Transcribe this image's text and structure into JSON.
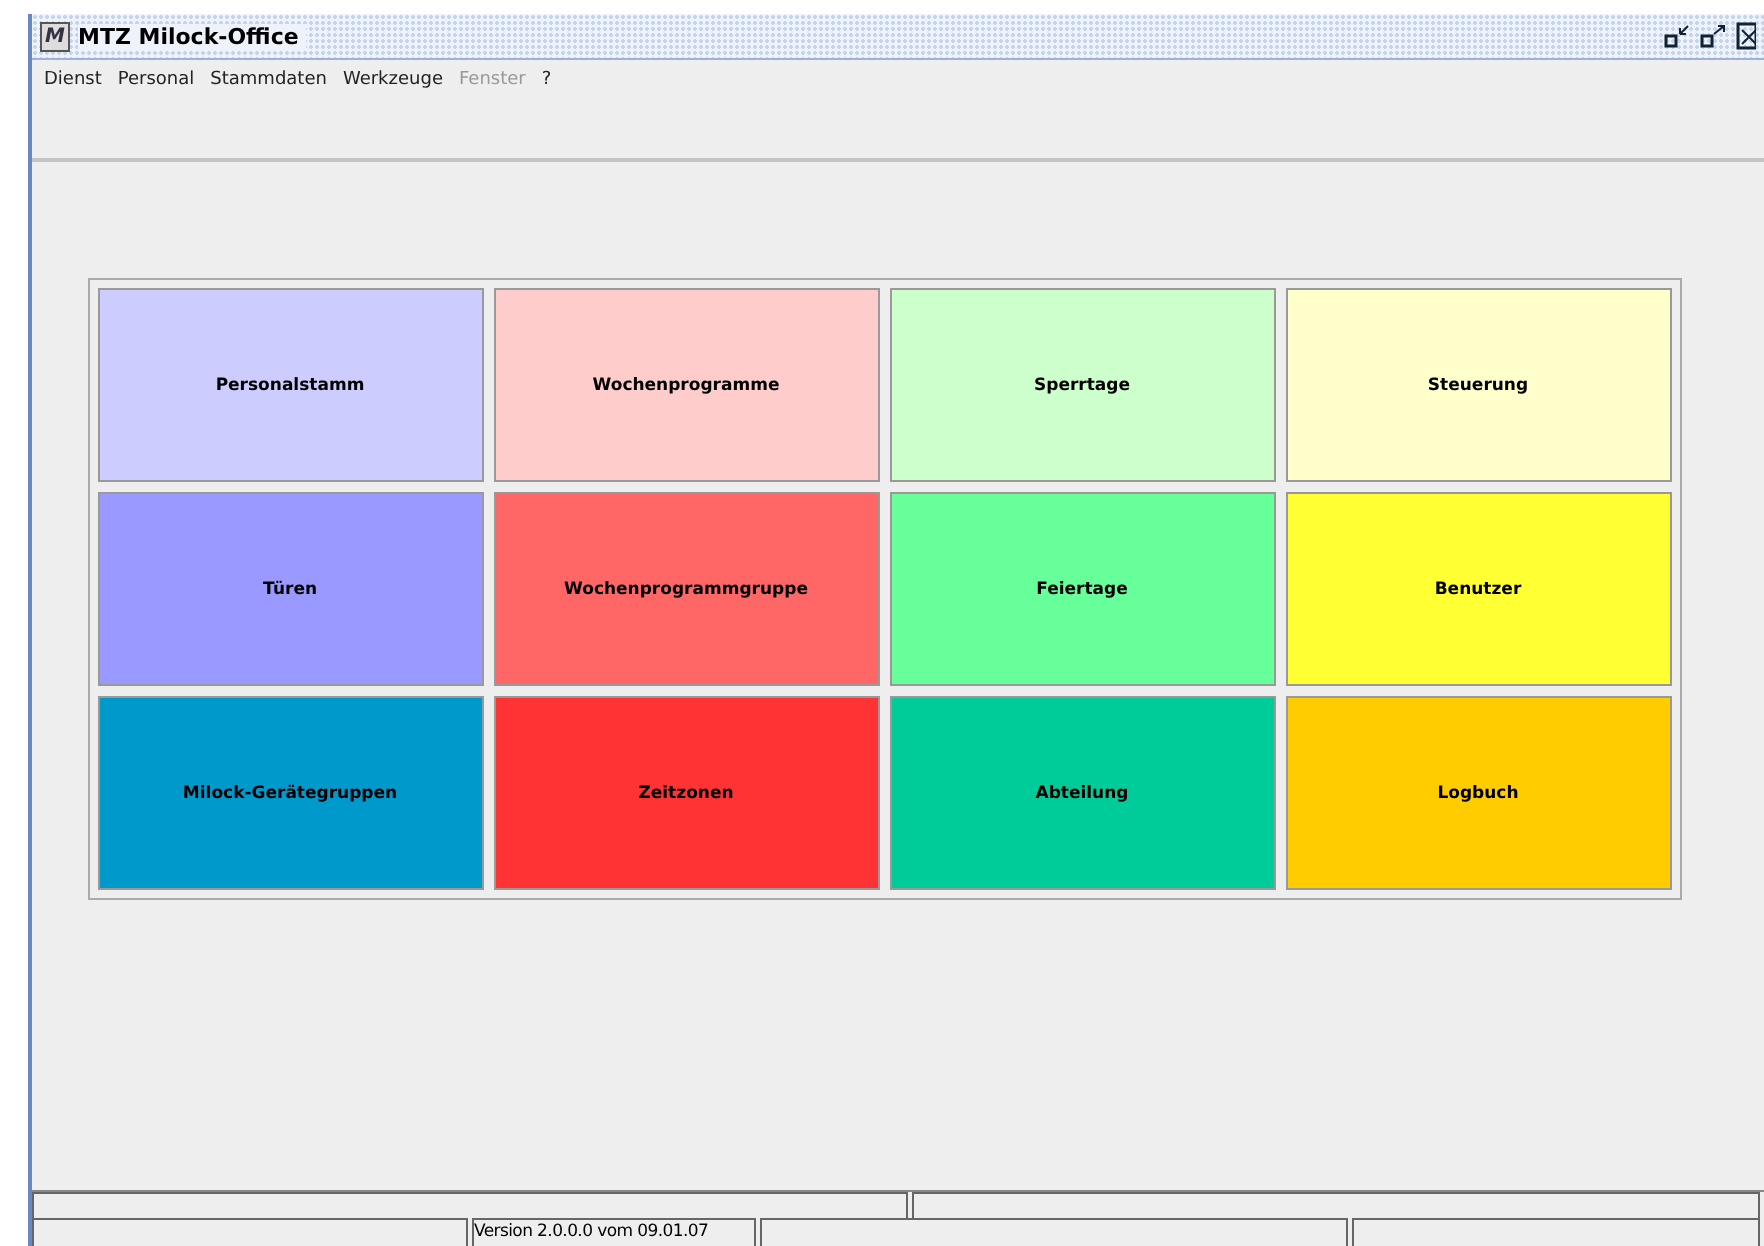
{
  "window": {
    "title": "MTZ Milock-Office",
    "logo": "M"
  },
  "menu": [
    {
      "label": "Dienst",
      "disabled": false
    },
    {
      "label": "Personal",
      "disabled": false
    },
    {
      "label": "Stammdaten",
      "disabled": false
    },
    {
      "label": "Werkzeuge",
      "disabled": false
    },
    {
      "label": "Fenster",
      "disabled": true
    },
    {
      "label": "?",
      "disabled": false
    }
  ],
  "tiles": [
    {
      "label": "Personalstamm",
      "color": "#ccccff"
    },
    {
      "label": "Wochenprogramme",
      "color": "#ffcccc"
    },
    {
      "label": "Sperrtage",
      "color": "#ccffcc"
    },
    {
      "label": "Steuerung",
      "color": "#ffffcc"
    },
    {
      "label": "Türen",
      "color": "#9999ff"
    },
    {
      "label": "Wochenprogrammgruppe",
      "color": "#ff6666"
    },
    {
      "label": "Feiertage",
      "color": "#66ff99"
    },
    {
      "label": "Benutzer",
      "color": "#ffff33"
    },
    {
      "label": "Milock-Gerätegruppen",
      "color": "#0099cc"
    },
    {
      "label": "Zeitzonen",
      "color": "#ff3333"
    },
    {
      "label": "Abteilung",
      "color": "#00cc99"
    },
    {
      "label": "Logbuch",
      "color": "#ffcc00"
    }
  ],
  "status_bar": {
    "version": "Version 2.0.0.0 vom 09.01.07"
  }
}
